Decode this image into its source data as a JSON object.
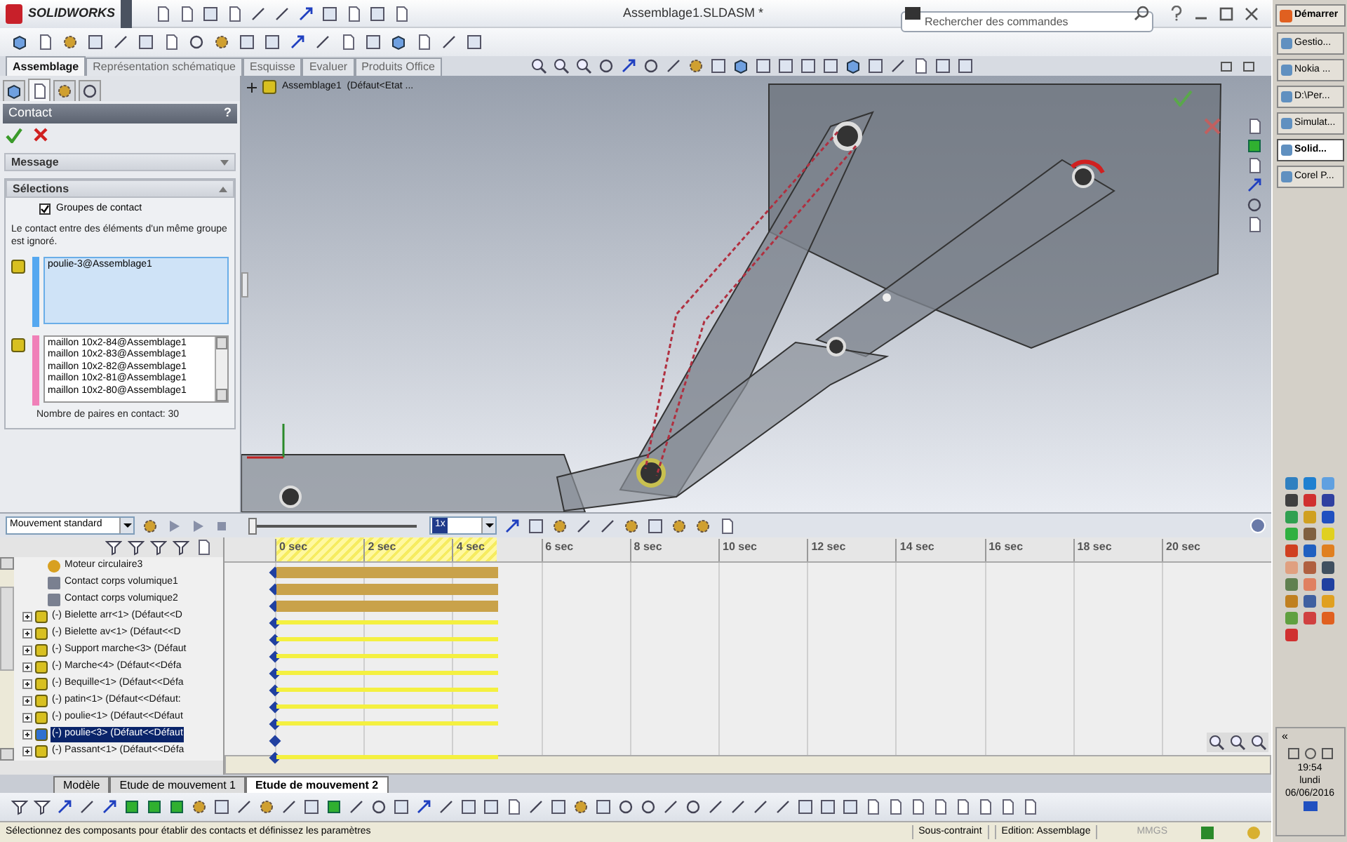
{
  "panel_tabs": [
    {
      "selected": false
    },
    {
      "selected": true
    },
    {
      "selected": false
    },
    {
      "selected": false
    }
  ],
  "app": {
    "logo": "SOLIDWORKS",
    "title": "Assemblage1.SLDASM *",
    "search": {
      "placeholder": "Rechercher des commandes"
    }
  },
  "ribbon_tabs": [
    {
      "label": "Assemblage",
      "selected": true
    },
    {
      "label": "Représentation schématique",
      "selected": false
    },
    {
      "label": "Esquisse",
      "selected": false
    },
    {
      "label": "Evaluer",
      "selected": false
    },
    {
      "label": "Produits Office",
      "selected": false
    }
  ],
  "property_manager": {
    "title": "Contact",
    "help": "?",
    "sections": [
      {
        "title": "Message",
        "expanded": false
      },
      {
        "title": "Sélections",
        "expanded": true
      }
    ],
    "contact_groups": {
      "label": "Groupes de contact",
      "checked": true
    },
    "info": "Le contact entre des éléments d'un même groupe est ignoré.",
    "group_1": [
      "poulie-3@Assemblage1"
    ],
    "group_2": [
      "maillon 10x2-84@Assemblage1",
      "maillon 10x2-83@Assemblage1",
      "maillon 10x2-82@Assemblage1",
      "maillon 10x2-81@Assemblage1",
      "maillon 10x2-80@Assemblage1"
    ],
    "pair_count": "Nombre de paires en contact: 30"
  },
  "viewport": {
    "tree_root": "Assemblage1  (Défaut<Etat ..."
  },
  "motion": {
    "study_type": "Mouvement standard",
    "speed": "1x",
    "slider": {
      "level": 0
    },
    "ticks": [
      "0 sec",
      "2 sec",
      "4 sec",
      "6 sec",
      "8 sec",
      "10 sec",
      "12 sec",
      "14 sec",
      "16 sec",
      "18 sec",
      "20 sec"
    ],
    "rows": [
      {
        "label": "Moteur circulaire3",
        "kind": "motor",
        "has_track": true,
        "selected": false
      },
      {
        "label": "Contact corps volumique1",
        "kind": "contact",
        "has_track": true,
        "selected": false
      },
      {
        "label": "Contact corps volumique2",
        "kind": "contact",
        "has_track": true,
        "selected": false
      },
      {
        "label": "(-) Bielette arr<1> (Défaut<<D",
        "kind": "part",
        "has_track": true,
        "selected": false
      },
      {
        "label": "(-) Bielette av<1> (Défaut<<D",
        "kind": "part",
        "has_track": true,
        "selected": false
      },
      {
        "label": "(-) Support marche<3> (Défaut",
        "kind": "part",
        "has_track": true,
        "selected": false
      },
      {
        "label": "(-) Marche<4> (Défaut<<Défa",
        "kind": "part",
        "has_track": true,
        "selected": false
      },
      {
        "label": "(-) Bequille<1> (Défaut<<Défa",
        "kind": "part",
        "has_track": true,
        "selected": false
      },
      {
        "label": "(-) patin<1> (Défaut<<Défaut:",
        "kind": "part",
        "has_track": true,
        "selected": false
      },
      {
        "label": "(-) poulie<1> (Défaut<<Défaut",
        "kind": "part",
        "has_track": true,
        "selected": false
      },
      {
        "label": "(-) poulie<3> (Défaut<<Défaut",
        "kind": "part",
        "has_track": false,
        "selected": true
      },
      {
        "label": "(-) Passant<1> (Défaut<<Défa",
        "kind": "part",
        "has_track": true,
        "selected": false
      }
    ]
  },
  "bottom_tabs": [
    {
      "label": "Modèle",
      "selected": false
    },
    {
      "label": "Etude de mouvement 1",
      "selected": false
    },
    {
      "label": "Etude de mouvement 2",
      "selected": true
    }
  ],
  "status_bar": {
    "message": "Sélectionnez des composants pour établir des contacts et définissez les paramètres",
    "state": "Sous-contraint",
    "mode": "Edition: Assemblage",
    "units": "MMGS"
  },
  "taskbar": {
    "start": "Démarrer",
    "tasks": [
      {
        "label": "Gestio...",
        "selected": false
      },
      {
        "label": "Nokia ...",
        "selected": false
      },
      {
        "label": "D:\\Per...",
        "selected": false
      },
      {
        "label": "Simulat...",
        "selected": false
      },
      {
        "label": "Solid...",
        "selected": true
      },
      {
        "label": "Corel P...",
        "selected": false
      }
    ],
    "collapse": "«",
    "time": "19:54",
    "day": "lundi",
    "date": "06/06/2016"
  }
}
